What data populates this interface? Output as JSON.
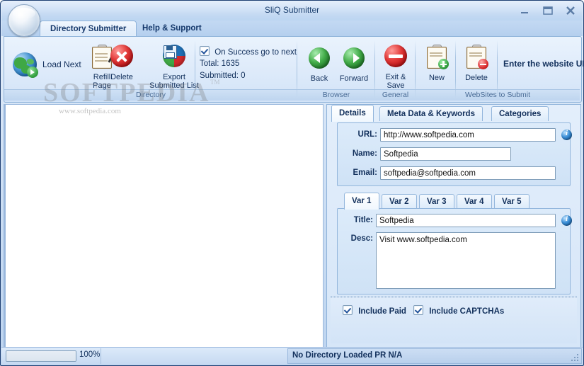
{
  "window": {
    "title": "SliQ Submitter",
    "minimize_label": "minimize-icon",
    "maximize_label": "maximize-icon",
    "close_label": "close-icon",
    "orb_icon": "app-orb-icon"
  },
  "ribbon": {
    "tabs": [
      {
        "label": "Directory Submitter",
        "active": true
      },
      {
        "label": "Help & Support",
        "active": false
      }
    ],
    "groups": [
      {
        "label": "Directory"
      },
      {
        "label": "Browser"
      },
      {
        "label": "General"
      },
      {
        "label": "WebSites to Submit"
      }
    ],
    "directory": {
      "load_next": "Load Next",
      "refill_page_line1": "Refill",
      "refill_page_line2": "Page",
      "delete": "Delete",
      "export_line1": "Export",
      "export_line2": "Submitted List",
      "on_success_label": "On Success go to next",
      "on_success_checked": true,
      "total": "Total: 1635",
      "submitted": "Submitted: 0"
    },
    "browser": {
      "back": "Back",
      "forward": "Forward"
    },
    "general": {
      "exit_line1": "Exit &",
      "exit_line2": "Save"
    },
    "websites": {
      "new": "New",
      "delete": "Delete",
      "url_combo": "Enter the website URL"
    }
  },
  "watermark": {
    "big": "SOFTPEDIA",
    "small": "www.softpedia.com",
    "tm": "TM"
  },
  "details_panel": {
    "tabs": [
      {
        "label": "Details",
        "active": true
      },
      {
        "label": "Meta Data & Keywords",
        "active": false
      },
      {
        "label": "Categories",
        "active": false
      }
    ],
    "fields": [
      {
        "label": "URL:",
        "value": "http://www.softpedia.com",
        "placeholder": ""
      },
      {
        "label": "Name:",
        "value": "Softpedia",
        "placeholder": ""
      },
      {
        "label": "Email:",
        "value": "softpedia@softpedia.com",
        "placeholder": ""
      }
    ],
    "url_info_icon": "info-icon"
  },
  "var_panel": {
    "tabs": [
      {
        "label": "Var 1",
        "active": true
      },
      {
        "label": "Var 2",
        "active": false
      },
      {
        "label": "Var 3",
        "active": false
      },
      {
        "label": "Var 4",
        "active": false
      },
      {
        "label": "Var 5",
        "active": false
      }
    ],
    "title_label": "Title:",
    "title_value": "Softpedia",
    "desc_label": "Desc:",
    "desc_value": "Visit www.softpedia.com",
    "title_info_icon": "info-icon"
  },
  "options": {
    "include_paid": {
      "label": "Include Paid",
      "checked": true
    },
    "include_captchas": {
      "label": "Include CAPTCHAs",
      "checked": true
    }
  },
  "statusbar": {
    "progress_percent": 100,
    "progress_text": "100%",
    "status_text": "No Directory Loaded  PR N/A"
  },
  "colors": {
    "accent": "#12305c",
    "window_border": "#1e3f73",
    "panel_bg": "#d6e6f8",
    "tab_active": "#ffffff",
    "group_label": "#4a6c96"
  }
}
